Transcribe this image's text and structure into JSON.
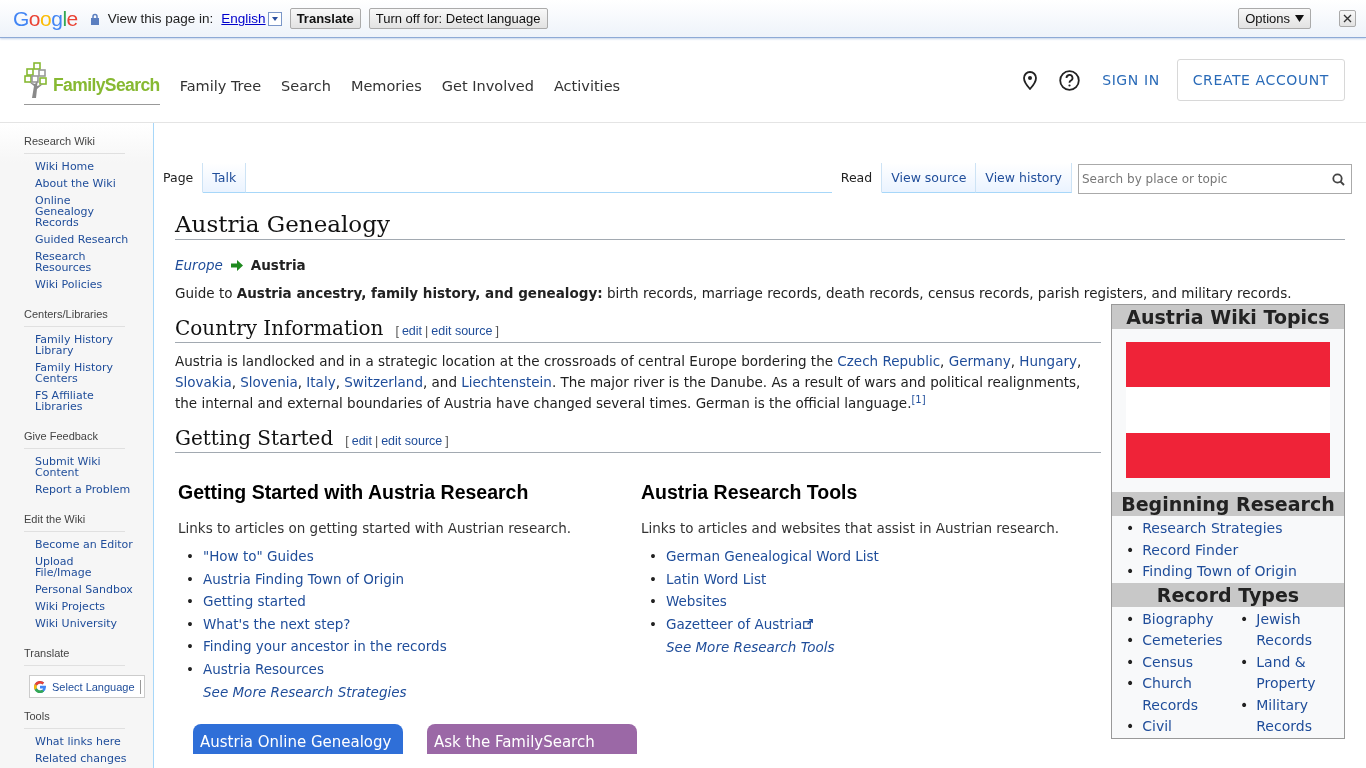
{
  "translate_bar": {
    "logo": "Google",
    "label": "View this page in:",
    "language": "English",
    "buttons": [
      "Translate",
      "Turn off for: Detect language"
    ],
    "options": "Options"
  },
  "header": {
    "logo": "FamilySearch",
    "nav": [
      "Family Tree",
      "Search",
      "Memories",
      "Get Involved",
      "Activities"
    ],
    "sign_in": "SIGN IN",
    "create_account": "CREATE ACCOUNT"
  },
  "sidebar": [
    {
      "kind": "links",
      "title": "Research Wiki",
      "items": [
        "Wiki Home",
        "About the Wiki",
        "Online Genealogy Records",
        "Guided Research",
        "Research Resources",
        "Wiki Policies"
      ]
    },
    {
      "kind": "links",
      "title": "Centers/Libraries",
      "items": [
        "Family History Library",
        "Family History Centers",
        "FS Affiliate Libraries"
      ]
    },
    {
      "kind": "links",
      "title": "Give Feedback",
      "items": [
        "Submit Wiki Content",
        "Report a Problem"
      ]
    },
    {
      "kind": "links",
      "title": "Edit the Wiki",
      "items": [
        "Become an Editor",
        "Upload File/Image",
        "Personal Sandbox",
        "Wiki Projects",
        "Wiki University"
      ]
    },
    {
      "kind": "language",
      "title": "Translate",
      "label": "Select Language"
    },
    {
      "kind": "links",
      "title": "Tools",
      "items": [
        "What links here",
        "Related changes"
      ]
    }
  ],
  "page_tabs": [
    {
      "label": "Page",
      "selected": true
    },
    {
      "label": "Talk",
      "selected": false
    }
  ],
  "view_tabs": [
    {
      "label": "Read",
      "selected": true
    },
    {
      "label": "View source",
      "selected": false
    },
    {
      "label": "View history",
      "selected": false
    }
  ],
  "search": {
    "placeholder": "Search by place or topic"
  },
  "article": {
    "title": "Austria Genealogy",
    "breadcrumb": {
      "parent": "Europe",
      "current": "Austria"
    },
    "intro": "Guide to **Austria ancestry, family history, and genealogy:** birth records, marriage records, death records, census records, parish registers, and military records.",
    "sections": [
      {
        "kind": "paragraph",
        "heading": "Country Information",
        "edit_links": {
          "open": "[",
          "links": [
            "edit",
            "edit source"
          ],
          "separator": "|",
          "close": "]"
        },
        "parts": [
          {
            "kind": "text",
            "text": "Austria is landlocked and in a strategic location at the crossroads of central Europe bordering the "
          },
          {
            "kind": "link",
            "text": "Czech Republic"
          },
          {
            "kind": "text",
            "text": ", "
          },
          {
            "kind": "link",
            "text": "Germany"
          },
          {
            "kind": "text",
            "text": ", "
          },
          {
            "kind": "link",
            "text": "Hungary"
          },
          {
            "kind": "text",
            "text": ", "
          },
          {
            "kind": "link",
            "text": "Slovakia"
          },
          {
            "kind": "text",
            "text": ", "
          },
          {
            "kind": "link",
            "text": "Slovenia"
          },
          {
            "kind": "text",
            "text": ", "
          },
          {
            "kind": "link",
            "text": "Italy"
          },
          {
            "kind": "text",
            "text": ", "
          },
          {
            "kind": "link",
            "text": "Switzerland"
          },
          {
            "kind": "text",
            "text": ", and "
          },
          {
            "kind": "link",
            "text": "Liechtenstein"
          },
          {
            "kind": "text",
            "text": ". The major river is the Danube. As a result of wars and political realignments, the internal and external boundaries of Austria have changed several times. German is the official language."
          },
          {
            "kind": "ref",
            "text": "[1]"
          }
        ]
      },
      {
        "kind": "columns",
        "heading": "Getting Started",
        "edit_links": {
          "open": "[",
          "links": [
            "edit",
            "edit source"
          ],
          "separator": "|",
          "close": "]"
        },
        "columns": [
          {
            "title": "Getting Started with Austria Research",
            "description": "Links to articles on getting started with Austrian research.",
            "bullet": "•",
            "links": [
              {
                "text": "\"How to\" Guides",
                "external": false
              },
              {
                "text": "Austria Finding Town of Origin",
                "external": false
              },
              {
                "text": "Getting started",
                "external": false
              },
              {
                "text": "What's the next step?",
                "external": false
              },
              {
                "text": "Finding your ancestor in the records",
                "external": false
              },
              {
                "text": "Austria Resources",
                "external": false
              }
            ],
            "more": "See More Research Strategies"
          },
          {
            "title": "Austria Research Tools",
            "description": "Links to articles and websites that assist in Austrian research.",
            "bullet": "•",
            "links": [
              {
                "text": "German Genealogical Word List",
                "external": false
              },
              {
                "text": "Latin Word List",
                "external": false
              },
              {
                "text": "Websites",
                "external": false
              },
              {
                "text": "Gazetteer of Austria",
                "external": true
              }
            ],
            "more": "See More Research Tools"
          }
        ],
        "buttons": [
          {
            "label": "Austria Online Genealogy",
            "color": "#2f6fd8"
          },
          {
            "label": "Ask the FamilySearch",
            "color": "#9b68a6"
          }
        ]
      }
    ]
  },
  "infobox": {
    "title": "Austria Wiki Topics",
    "sections": [
      {
        "title": "Beginning Research",
        "bullet": "•",
        "columns": [
          [
            "Research Strategies",
            "Record Finder",
            "Finding Town of Origin"
          ]
        ]
      },
      {
        "title": "Record Types",
        "bullet": "•",
        "columns": [
          [
            "Biography",
            "Cemeteries",
            "Census",
            "Church Records",
            "Civil"
          ],
          [
            "Jewish Records",
            "Land & Property",
            "Military Records"
          ]
        ]
      }
    ]
  }
}
